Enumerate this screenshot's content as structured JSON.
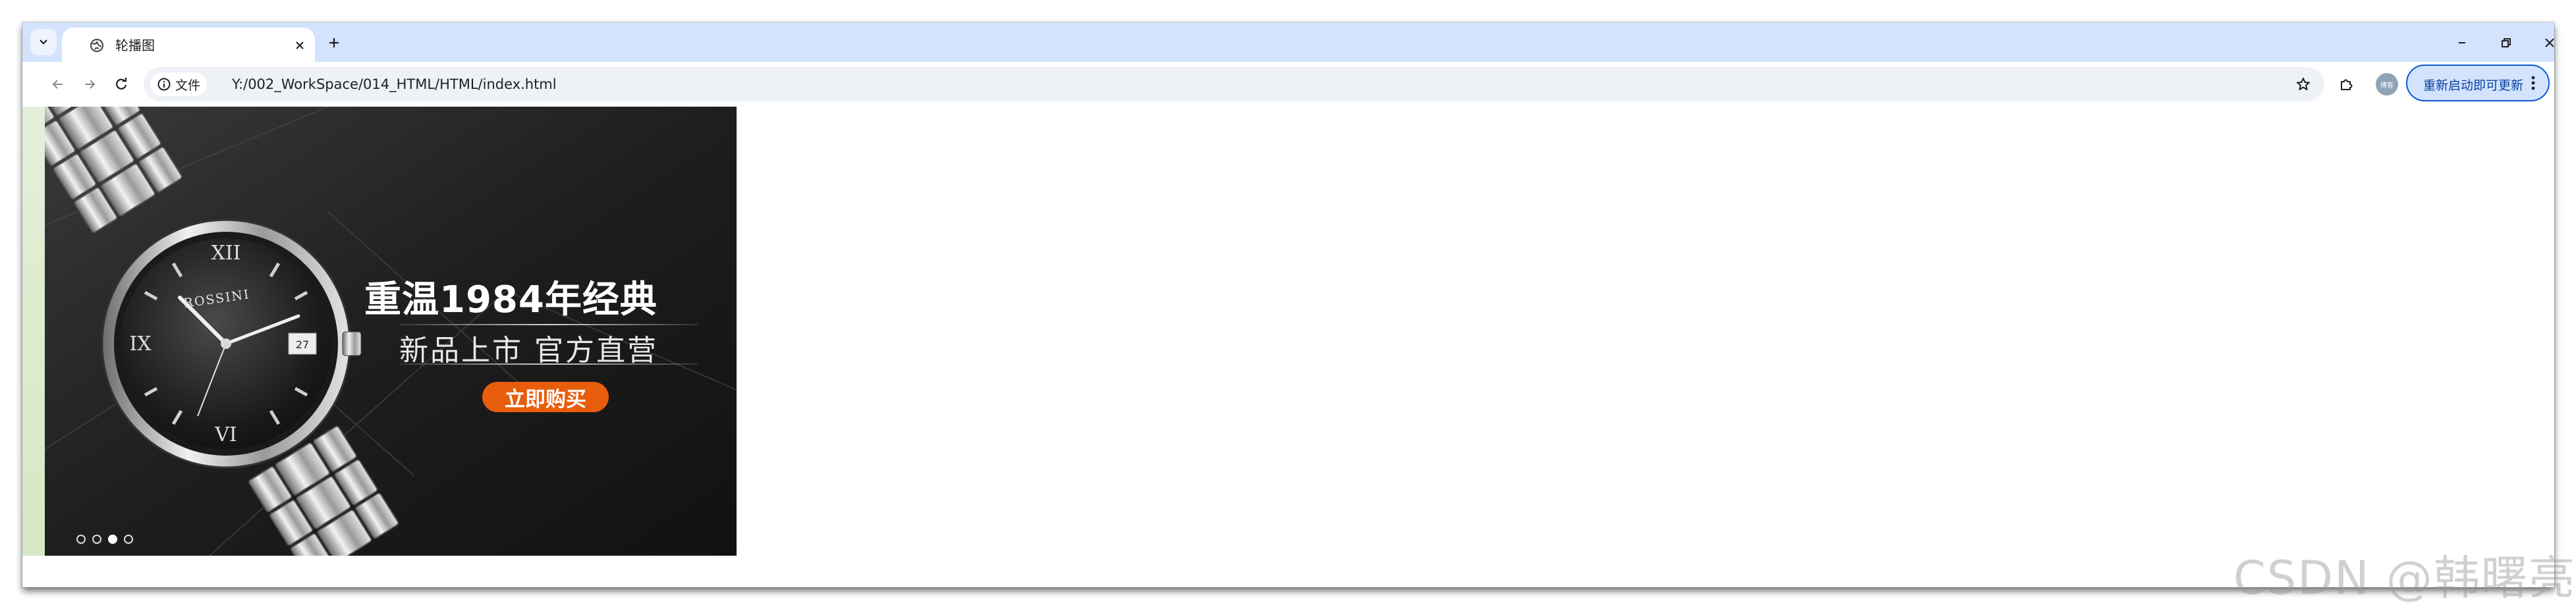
{
  "browser": {
    "tab": {
      "title": "轮播图",
      "icon": "globe-icon"
    },
    "new_tab_icon": "plus-icon",
    "window_controls": [
      "minimize-icon",
      "restore-icon",
      "close-icon"
    ]
  },
  "toolbar": {
    "security_label": "文件",
    "url": "Y:/002_WorkSpace/014_HTML/HTML/index.html",
    "profile_initials": "博客",
    "update_label": "重新启动即可更新"
  },
  "slide": {
    "headline": "重温1984年经典",
    "subline": "新品上市 官方直营",
    "button": "立即购买",
    "brand": "ROSSINI",
    "dots": [
      {
        "active": false
      },
      {
        "active": false
      },
      {
        "active": true
      },
      {
        "active": false
      }
    ]
  },
  "watermark": "CSDN @韩曙亮",
  "colors": {
    "tab_strip": "#d3e3fd",
    "accent": "#0b57d0",
    "buy_button": "#e85d0c"
  }
}
